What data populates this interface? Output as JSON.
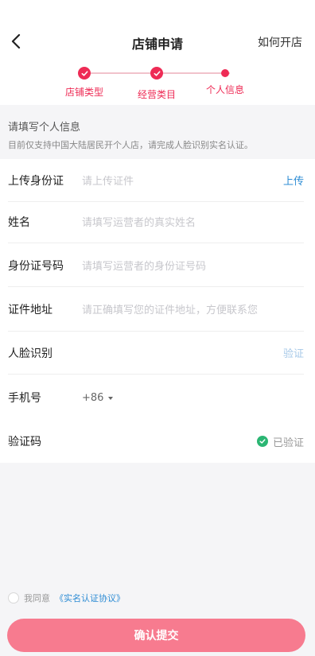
{
  "header": {
    "title": "店铺申请",
    "help_link": "如何开店"
  },
  "steps": [
    {
      "label": "店铺类型",
      "state": "done"
    },
    {
      "label": "经营类目",
      "state": "done"
    },
    {
      "label": "个人信息",
      "state": "current"
    }
  ],
  "notice": {
    "title": "请填写个人信息",
    "desc": "目前仅支持中国大陆居民开个人店，请完成人脸识别实名认证。"
  },
  "form": {
    "id_upload": {
      "label": "上传身份证",
      "placeholder": "请上传证件",
      "action": "上传"
    },
    "name": {
      "label": "姓名",
      "placeholder": "请填写运营者的真实姓名"
    },
    "id_number": {
      "label": "身份证号码",
      "placeholder": "请填写运营者的身份证号码"
    },
    "address": {
      "label": "证件地址",
      "placeholder": "请正确填写您的证件地址，方便联系您"
    },
    "face": {
      "label": "人脸识别",
      "action": "验证"
    },
    "phone": {
      "label": "手机号",
      "country_code": "+86"
    },
    "code": {
      "label": "验证码",
      "status": "已验证"
    }
  },
  "agreement": {
    "prefix": "我同意",
    "link": "《实名认证协议》"
  },
  "submit_label": "确认提交",
  "colors": {
    "accent": "#ee2b55",
    "link": "#2d8cd4",
    "success": "#2bb673",
    "button": "#f77b8f"
  }
}
